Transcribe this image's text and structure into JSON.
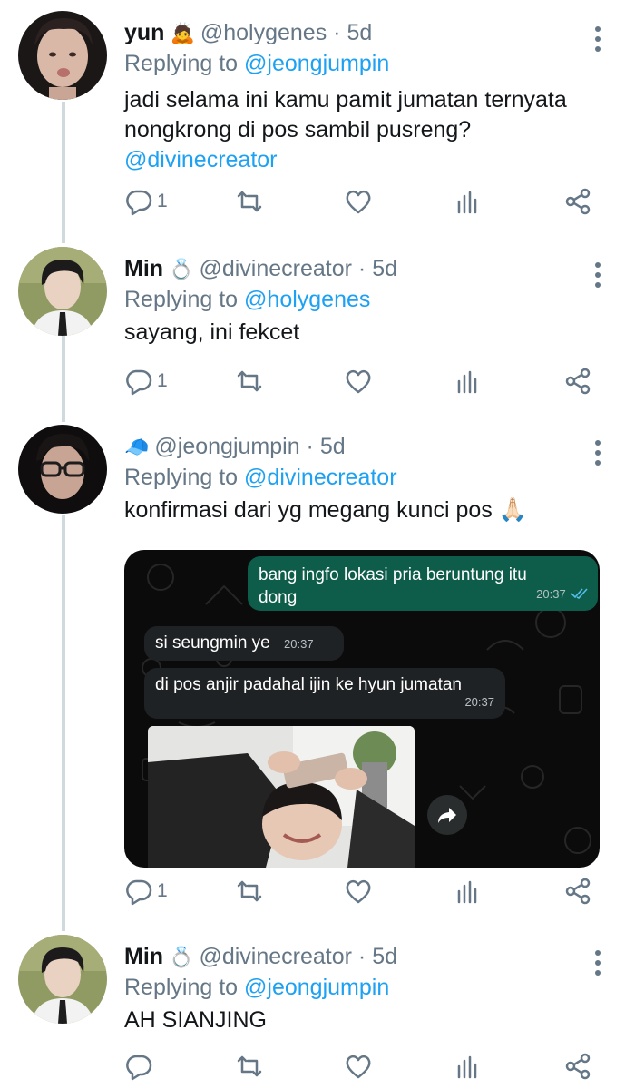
{
  "tweets": [
    {
      "name": "yun",
      "badge": "🙇",
      "handle": "@holygenes",
      "time": "5d",
      "reply_prefix": "Replying to",
      "reply_to": "@jeongjumpin",
      "text_line1": "jadi selama ini kamu pamit jumatan ternyata",
      "text_line2": "nongkrong di pos sambil pusreng?",
      "mention": "@divinecreator",
      "reply_count": "1"
    },
    {
      "name": "Min",
      "badge": "💍",
      "handle": "@divinecreator",
      "time": "5d",
      "reply_prefix": "Replying to",
      "reply_to": "@holygenes",
      "text": "sayang, ini fekcet",
      "reply_count": "1"
    },
    {
      "name": "",
      "badge": "🧢",
      "handle": "@jeongjumpin",
      "time": "5d",
      "reply_prefix": "Replying to",
      "reply_to": "@divinecreator",
      "text": "konfirmasi dari yg megang kunci pos",
      "text_emoji": "🙏🏻",
      "reply_count": "1",
      "chat": {
        "msg1": "bang ingfo lokasi pria beruntung itu dong",
        "msg1_time": "20:37",
        "msg2": "si seungmin ye",
        "msg2_time": "20:37",
        "msg3": "di pos anjir padahal ijin ke hyun jumatan",
        "msg3_time": "20:37"
      }
    },
    {
      "name": "Min",
      "badge": "💍",
      "handle": "@divinecreator",
      "time": "5d",
      "reply_prefix": "Replying to",
      "reply_to": "@jeongjumpin",
      "text": "AH SIANJING",
      "reply_count": ""
    }
  ],
  "colors": {
    "link": "#1da1f2",
    "muted": "#657786",
    "thread_line": "#cfd9de",
    "wa_out": "#0d5d4a"
  },
  "icons": [
    "reply-icon",
    "retweet-icon",
    "like-icon",
    "stats-icon",
    "share-icon",
    "more-icon"
  ]
}
